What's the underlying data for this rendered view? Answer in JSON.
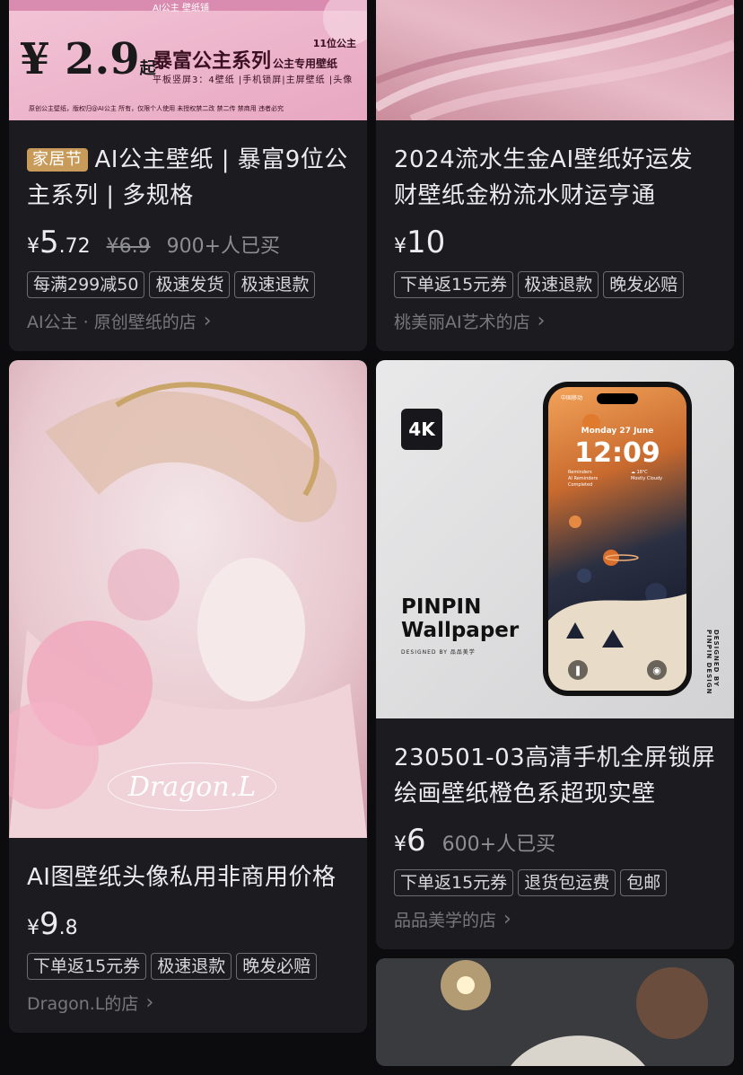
{
  "cards": [
    {
      "id": "c1",
      "festival_tag": "家居节",
      "title": "AI公主壁纸 | 暴富9位公主系列 | 多规格",
      "currency": "¥",
      "price_int": "5",
      "price_dec": ".72",
      "orig_price": "¥6.9",
      "sold": "900+人已买",
      "chips": [
        "每满299减50",
        "极速发货",
        "极速退款"
      ],
      "shop": "AI公主 · 原创壁纸的店",
      "banner": {
        "price": "¥ 2.9",
        "price_suffix": "起",
        "series": "暴富公主系列",
        "tag": "11位公主",
        "tag2": "公主专用壁纸",
        "sub": "平板竖屏3：4壁纸 |手机锁屏|主屏壁纸 |头像",
        "foot": "原创公主壁纸，版权归@AI公主 所有，仅限个人使用 未授权禁二改 禁二传 禁商用 违者必究",
        "top": "AI公主 壁纸铺"
      }
    },
    {
      "id": "c2",
      "title": "2024流水生金AI壁纸好运发财壁纸金粉流水财运亨通",
      "currency": "¥",
      "price_int": "10",
      "price_dec": "",
      "chips": [
        "下单返15元券",
        "极速退款",
        "晚发必赔"
      ],
      "shop": "桃美丽AI艺术的店"
    },
    {
      "id": "c3",
      "title": "AI图壁纸头像私用非商用价格",
      "currency": "¥",
      "price_int": "9",
      "price_dec": ".8",
      "chips": [
        "下单返15元券",
        "极速退款",
        "晚发必赔"
      ],
      "shop": "Dragon.L的店",
      "image_text": "Dragon.L"
    },
    {
      "id": "c4",
      "title": "230501-03高清手机全屏锁屏绘画壁纸橙色系超现实壁",
      "currency": "¥",
      "price_int": "6",
      "price_dec": "",
      "sold": "600+人已买",
      "chips": [
        "下单返15元券",
        "退货包运费",
        "包邮"
      ],
      "shop": "品品美学的店",
      "poster": {
        "badge": "4K",
        "brand_line1": "PINPIN",
        "brand_line2": "Wallpaper",
        "designed": "DESIGNED BY 品品美学",
        "vertical": "DESIGNED BY PINPIN DESIGN",
        "carrier": "中国移动",
        "date": "Monday 27 June",
        "time": "12:09",
        "reminders": "Reminders\nAI Reminders\nCompleted",
        "weather": "☁ 18℃\nMostly Cloudy"
      }
    }
  ],
  "colors": {
    "background": "#0c0c0e",
    "card": "#1c1c20",
    "festival_tag": "#c99b5b"
  }
}
